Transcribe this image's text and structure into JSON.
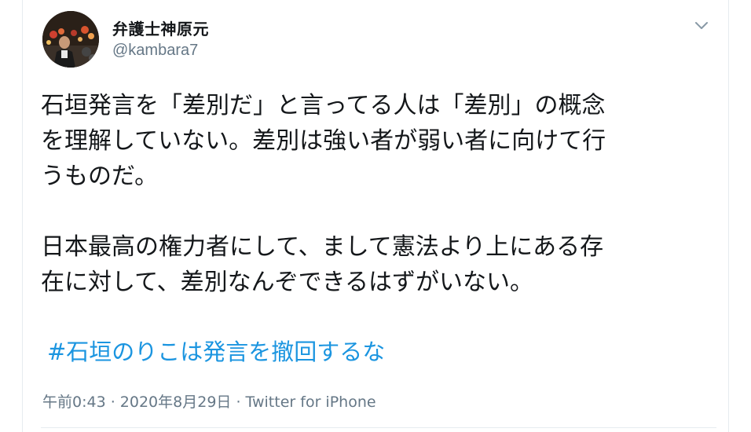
{
  "tweet": {
    "author": {
      "display_name": "弁護士神原元",
      "handle": "@kambara7",
      "avatar_icon": "profile-photo"
    },
    "menu_icon": "chevron-down-icon",
    "lines": [
      "石垣発言を「差別だ」と言ってる人は「差別」の概念",
      "を理解していない。差別は強い者が弱い者に向けて行",
      "うものだ。",
      "日本最高の権力者にして、まして憲法より上にある存",
      "在に対して、差別なんぞできるはずがいない。"
    ],
    "hashtag": "#石垣のりこは発言を撤回するな",
    "timestamp": "午前0:43 · 2020年8月29日",
    "separator": " · ",
    "source": "Twitter for iPhone"
  },
  "colors": {
    "text": "#14171a",
    "secondary": "#657786",
    "link": "#1b95e0",
    "border": "#e6ecf0"
  }
}
